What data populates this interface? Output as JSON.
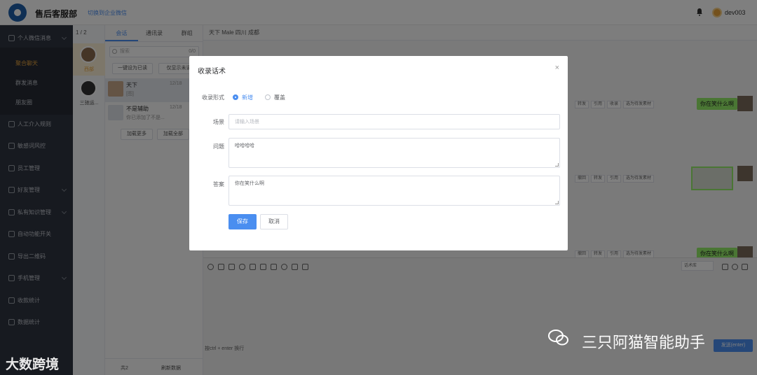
{
  "header": {
    "app_title": "售后客服部",
    "switch_link": "切换到企业微信",
    "username": "dev003"
  },
  "sidebar": {
    "items": [
      {
        "label": "个人微信消息",
        "icon": "user-icon",
        "active": false,
        "sub": false
      },
      {
        "label": "聚合聊天",
        "icon": "",
        "active": true,
        "sub": true
      },
      {
        "label": "群发消息",
        "icon": "",
        "active": false,
        "sub": true
      },
      {
        "label": "朋友圈",
        "icon": "",
        "active": false,
        "sub": true
      },
      {
        "label": "人工介入规则",
        "icon": "reply-icon",
        "active": false,
        "sub": false
      },
      {
        "label": "敏感词风控",
        "icon": "search-icon",
        "active": false,
        "sub": false
      },
      {
        "label": "员工管理",
        "icon": "users-icon",
        "active": false,
        "sub": false
      },
      {
        "label": "好友管理",
        "icon": "gear-icon",
        "active": false,
        "sub": false
      },
      {
        "label": "私有知识管理",
        "icon": "gear-icon",
        "active": false,
        "sub": false
      },
      {
        "label": "自动功能开关",
        "icon": "switch-icon",
        "active": false,
        "sub": false
      },
      {
        "label": "导出二维码",
        "icon": "qrcode-icon",
        "active": false,
        "sub": false
      },
      {
        "label": "手机管理",
        "icon": "phone-icon",
        "active": false,
        "sub": false
      },
      {
        "label": "收款统计",
        "icon": "chart-icon",
        "active": false,
        "sub": false
      },
      {
        "label": "数据统计",
        "icon": "chart-icon",
        "active": false,
        "sub": false
      }
    ]
  },
  "contacts": {
    "count": "1 / 2",
    "items": [
      {
        "name": "西部"
      },
      {
        "name": "三驰运..."
      }
    ]
  },
  "chatlist": {
    "tabs": [
      "会话",
      "通讯录",
      "群组"
    ],
    "search_placeholder": "搜索",
    "search_count": "0/0",
    "btn_mark_read": "一键设为已读",
    "btn_unread": "仅显示未读",
    "items": [
      {
        "name": "天下",
        "sub": "[图]",
        "time": "12/18"
      },
      {
        "name": "不是辅助",
        "sub": "你已添加了不是...",
        "time": "12/18"
      }
    ],
    "btn_load_more": "加载更多",
    "btn_load_all": "加载全部",
    "footer_total": "共2",
    "footer_refresh": "刷新数据"
  },
  "chat": {
    "head": "天下  Male  四川  成都",
    "bubble_text": "你在笑什么啊",
    "tools": [
      "转发",
      "引用",
      "收录",
      "选为待发素材"
    ],
    "tools_row2": [
      "撤回",
      "转发",
      "引用",
      "选为待发素材"
    ],
    "input_hint": "按ctrl + enter 换行",
    "send_label": "发送(enter)",
    "select_label": "话术库"
  },
  "modal": {
    "title": "收录话术",
    "close": "×",
    "type_label": "收录形式",
    "type_options": [
      {
        "label": "新增",
        "checked": true
      },
      {
        "label": "覆盖",
        "checked": false
      }
    ],
    "scene_label": "场景",
    "scene_placeholder": "请输入场景",
    "question_label": "问题",
    "question_value": "哈哈哈哈",
    "answer_label": "答案",
    "answer_value": "你在笑什么啊",
    "save_label": "保存",
    "cancel_label": "取消"
  },
  "watermark": {
    "left": "大数跨境",
    "right": "三只阿猫智能助手"
  }
}
